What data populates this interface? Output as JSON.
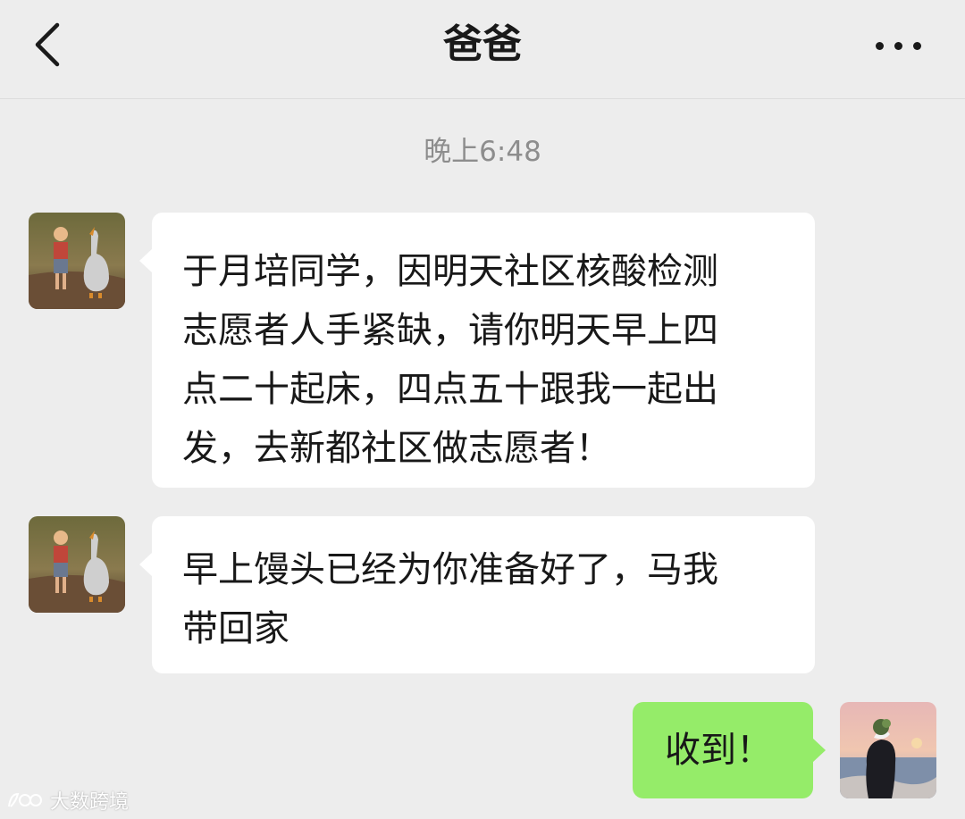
{
  "header": {
    "title": "爸爸",
    "back_icon": "chevron-left-icon",
    "more_icon": "more-dots-icon"
  },
  "chat": {
    "timestamp": "晚上6:48",
    "messages": [
      {
        "sender": "爸爸",
        "direction": "incoming",
        "lines": [
          "于月培同学，因明天社区核酸检测",
          "志愿者人手紧缺，请你明天早上四",
          "点二十起床，四点五十跟我一起出",
          "发，去新都社区做志愿者！"
        ]
      },
      {
        "sender": "爸爸",
        "direction": "incoming",
        "lines": [
          "早上馒头已经为你准备好了，马我",
          "带回家"
        ]
      },
      {
        "sender": "me",
        "direction": "outgoing",
        "lines": [
          "收到！"
        ]
      }
    ]
  },
  "watermark": {
    "text": "大数跨境"
  },
  "colors": {
    "background": "#ededed",
    "incoming_bubble": "#ffffff",
    "outgoing_bubble": "#95ec69",
    "timestamp_text": "#8d8d8d"
  }
}
